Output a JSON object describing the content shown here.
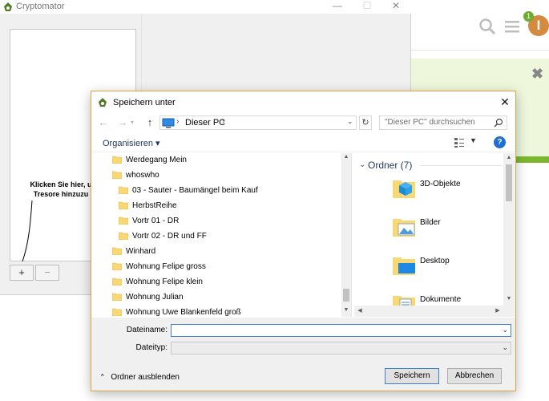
{
  "background_app": {
    "title": "Cryptomator",
    "window_controls": [
      "—",
      "☐",
      "✕"
    ],
    "hint": "Klicken Sie hier, u\nTresore hinzuzu",
    "add_button": "+",
    "remove_button": "−"
  },
  "background_web": {
    "notification_count": "1",
    "avatar_letter": "I",
    "banner_close": "✖",
    "accent_color": "#7cb82f"
  },
  "dialog": {
    "title": "Speichern unter",
    "close": "✕",
    "nav": {
      "back": "←",
      "forward": "→",
      "up": "↑",
      "address_path": "Dieser PC",
      "search_placeholder": "\"Dieser PC\" durchsuchen"
    },
    "organize_label": "Organisieren ▾",
    "help": "?",
    "tree_items": [
      {
        "label": "Werdegang Mein",
        "indent": 1
      },
      {
        "label": "whoswho",
        "indent": 1
      },
      {
        "label": "03 - Sauter - Baumängel beim Kauf",
        "indent": 2
      },
      {
        "label": "HerbstReihe",
        "indent": 2
      },
      {
        "label": "Vortr 01 - DR",
        "indent": 2
      },
      {
        "label": "Vortr 02 - DR und FF",
        "indent": 2
      },
      {
        "label": "Winhard",
        "indent": 1
      },
      {
        "label": "Wohnung Felipe gross",
        "indent": 1
      },
      {
        "label": "Wohnung Felipe klein",
        "indent": 1
      },
      {
        "label": "Wohnung Julian",
        "indent": 1
      },
      {
        "label": "Wohnung Uwe Blankenfeld groß",
        "indent": 1
      }
    ],
    "folder_group": {
      "header": "Ordner (7)",
      "items": [
        {
          "label": "3D-Objekte",
          "icon": "3d-objects-folder-icon"
        },
        {
          "label": "Bilder",
          "icon": "pictures-folder-icon"
        },
        {
          "label": "Desktop",
          "icon": "desktop-folder-icon"
        },
        {
          "label": "Dokumente",
          "icon": "documents-folder-icon"
        }
      ]
    },
    "filename_label": "Dateiname:",
    "filename_value": "",
    "filetype_label": "Dateityp:",
    "filetype_value": "",
    "hide_folders": "Ordner ausblenden",
    "save_button": "Speichern",
    "cancel_button": "Abbrechen"
  }
}
